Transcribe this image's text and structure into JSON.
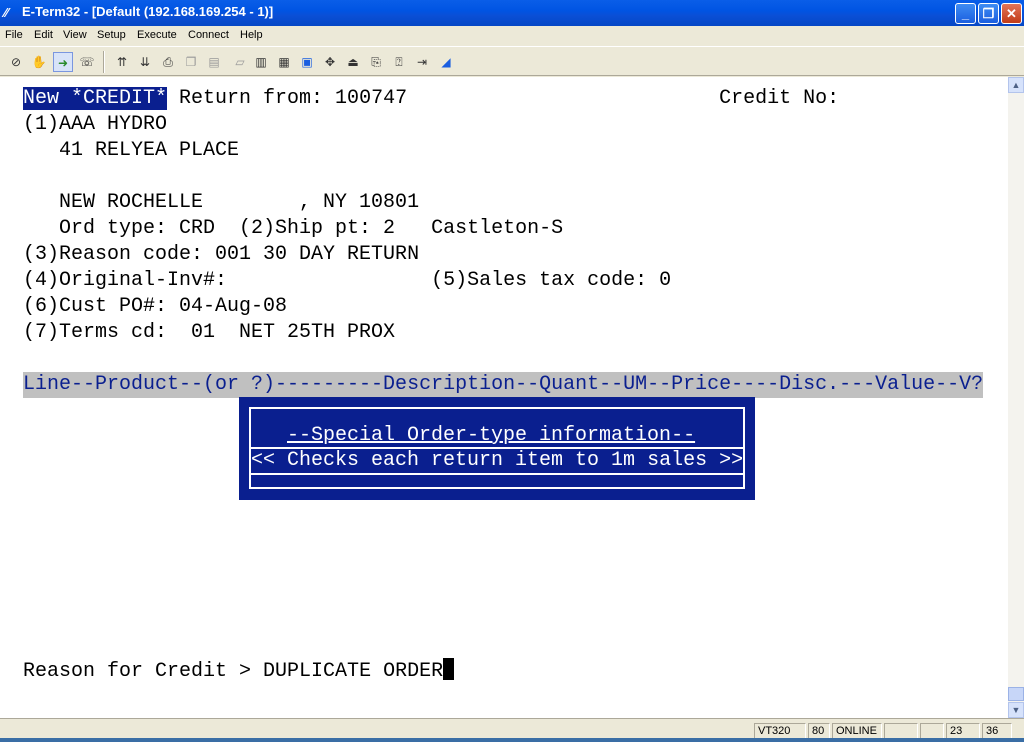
{
  "window": {
    "title": "E-Term32 - [Default (192.168.169.254 - 1)]",
    "app_icon": "eterm-app-icon",
    "buttons": {
      "minimize": "_",
      "restore": "❐",
      "close": "✕"
    }
  },
  "menu": [
    "File",
    "Edit",
    "View",
    "Setup",
    "Execute",
    "Connect",
    "Help"
  ],
  "toolbar": {
    "icons": [
      "disconnect-icon",
      "hand-icon",
      "connect-icon",
      "phone-icon",
      "upload-icon",
      "download-icon",
      "print-icon",
      "copy-icon",
      "paste-icon",
      "clear-icon",
      "columns-80-icon",
      "columns-132-icon",
      "screen-132-icon",
      "move-icon",
      "transfer-icon",
      "capture-icon",
      "macro-icon",
      "exit-icon",
      "settings-icon"
    ]
  },
  "terminal": {
    "line1_highlight": "New *CREDIT*",
    "line1_rest": " Return from: 100747                          Credit No:",
    "lines": [
      "(1)AAA HYDRO",
      "   41 RELYEA PLACE",
      "",
      "   NEW ROCHELLE        , NY 10801",
      "   Ord type: CRD  (2)Ship pt: 2   Castleton-S",
      "(3)Reason code: 001 30 DAY RETURN",
      "(4)Original-Inv#:                 (5)Sales tax code: 0",
      "(6)Cust PO#: 04-Aug-08",
      "(7)Terms cd:  01  NET 25TH PROX"
    ],
    "column_header": "Line--Product--(or ?)---------Description--Quant--UM--Price----Disc.---Value--V?",
    "popup": {
      "title": "--Special Order-type information--",
      "message": "<< Checks each return item to 1m sales >>"
    },
    "prompt_label": "Reason for Credit > ",
    "prompt_value": "DUPLICATE ORDER"
  },
  "scrollbar": {
    "up": "▲",
    "down": "▼"
  },
  "status": {
    "emulation": "VT320",
    "columns": "80",
    "state": "ONLINE",
    "blank1": "",
    "blank2": "",
    "row": "23",
    "col": "36"
  },
  "colors": {
    "terminal_highlight": "#0a1f8f",
    "header_bar": "#c0c0c0",
    "title_bar": "#0054e3"
  }
}
